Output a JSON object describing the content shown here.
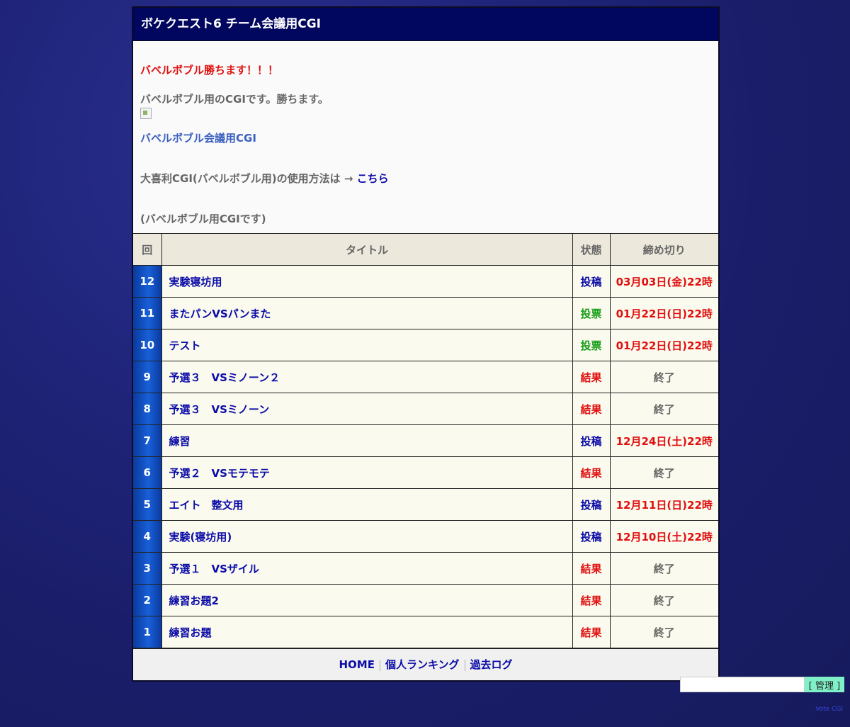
{
  "header": {
    "title": "ボケクエスト6 チーム会議用CGI"
  },
  "info": {
    "headline": "バベルボブル勝ちます！！！",
    "description": "バベルボブル用のCGIです。勝ちます。",
    "link_text": "バベルボブル会議用CGI",
    "usage_prefix": "大喜利CGI(バベルボブル用)の使用方法は → ",
    "usage_link": "こちら",
    "note": "(バベルボブル用CGIです)"
  },
  "table": {
    "headers": {
      "num": "回",
      "title": "タイトル",
      "status": "状態",
      "deadline": "締め切り"
    },
    "rows": [
      {
        "num": "12",
        "title": "実験寝坊用",
        "status": "投稿",
        "status_type": "post",
        "deadline": "03月03日(金)22時",
        "deadline_type": "red"
      },
      {
        "num": "11",
        "title": "またパンVSパンまた",
        "status": "投票",
        "status_type": "vote",
        "deadline": "01月22日(日)22時",
        "deadline_type": "red"
      },
      {
        "num": "10",
        "title": "テスト",
        "status": "投票",
        "status_type": "vote",
        "deadline": "01月22日(日)22時",
        "deadline_type": "red"
      },
      {
        "num": "9",
        "title": "予選３　VSミノーン２",
        "status": "結果",
        "status_type": "result",
        "deadline": "終了",
        "deadline_type": "gray"
      },
      {
        "num": "8",
        "title": "予選３　VSミノーン",
        "status": "結果",
        "status_type": "result",
        "deadline": "終了",
        "deadline_type": "gray"
      },
      {
        "num": "7",
        "title": "練習",
        "status": "投稿",
        "status_type": "post",
        "deadline": "12月24日(土)22時",
        "deadline_type": "red"
      },
      {
        "num": "6",
        "title": "予選２　VSモテモテ",
        "status": "結果",
        "status_type": "result",
        "deadline": "終了",
        "deadline_type": "gray"
      },
      {
        "num": "5",
        "title": "エイト　整文用",
        "status": "投稿",
        "status_type": "post",
        "deadline": "12月11日(日)22時",
        "deadline_type": "red"
      },
      {
        "num": "4",
        "title": "実験(寝坊用)",
        "status": "投稿",
        "status_type": "post",
        "deadline": "12月10日(土)22時",
        "deadline_type": "red"
      },
      {
        "num": "3",
        "title": "予選１　VSザイル",
        "status": "結果",
        "status_type": "result",
        "deadline": "終了",
        "deadline_type": "gray"
      },
      {
        "num": "2",
        "title": "練習お題2",
        "status": "結果",
        "status_type": "result",
        "deadline": "終了",
        "deadline_type": "gray"
      },
      {
        "num": "1",
        "title": "練習お題",
        "status": "結果",
        "status_type": "result",
        "deadline": "終了",
        "deadline_type": "gray"
      }
    ]
  },
  "footer": {
    "links": [
      "HOME",
      "個人ランキング",
      "過去ログ"
    ]
  },
  "admin": {
    "input_value": "",
    "button_label": "[ 管理 ]"
  },
  "credit": "Vote CGI",
  "colors": {
    "header_bg": "#01065e",
    "post": "#0b0ba8",
    "vote": "#1a9e1a",
    "result": "#e01010",
    "deadline_red": "#e01010",
    "deadline_gray": "#666666"
  }
}
